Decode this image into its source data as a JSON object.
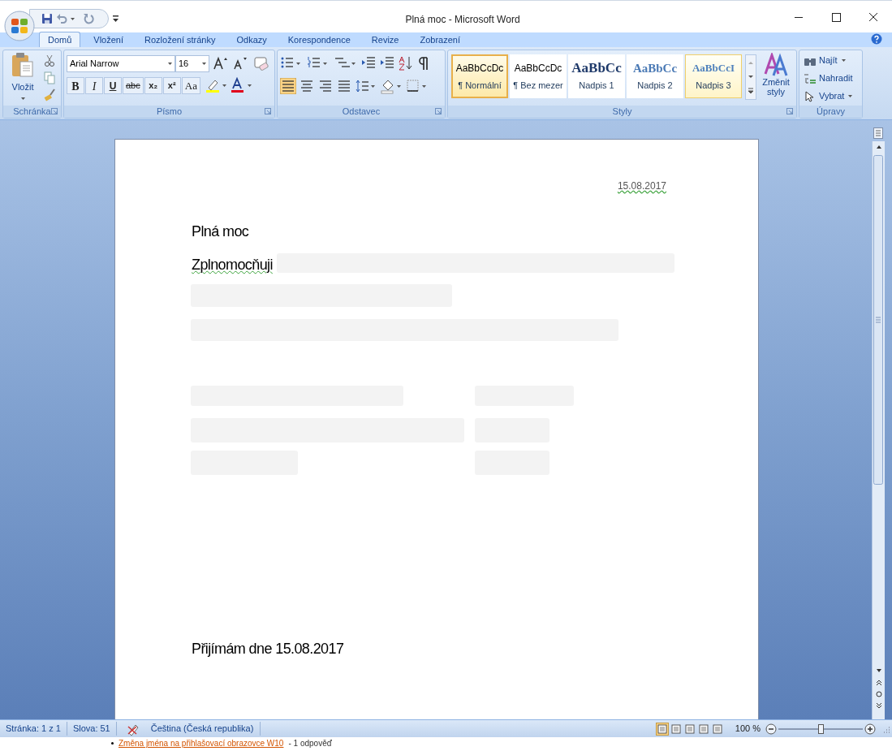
{
  "window": {
    "title": "Plná moc - Microsoft Word"
  },
  "tabs": [
    {
      "label": "Domů",
      "selected": true
    },
    {
      "label": "Vložení",
      "selected": false
    },
    {
      "label": "Rozložení stránky",
      "selected": false
    },
    {
      "label": "Odkazy",
      "selected": false
    },
    {
      "label": "Korespondence",
      "selected": false
    },
    {
      "label": "Revize",
      "selected": false
    },
    {
      "label": "Zobrazení",
      "selected": false
    }
  ],
  "ribbon": {
    "clipboard": {
      "label": "Schránka",
      "paste": "Vložit"
    },
    "font": {
      "label": "Písmo",
      "font_name": "Arial Narrow",
      "font_size": "16",
      "format_buttons": [
        {
          "kind": "bold",
          "text": "B"
        },
        {
          "kind": "italic",
          "text": "I"
        },
        {
          "kind": "underline",
          "text": "U"
        },
        {
          "kind": "strike",
          "text": "abc"
        },
        {
          "kind": "sub",
          "text": "x₂"
        },
        {
          "kind": "sup",
          "text": "x²"
        },
        {
          "kind": "case",
          "text": "Aa"
        }
      ]
    },
    "paragraph": {
      "label": "Odstavec"
    },
    "styles": {
      "label": "Styly",
      "items": [
        {
          "kind": "normal",
          "sample": "AaBbCcDc",
          "name": "¶ Normální",
          "selected": true,
          "hovered": false
        },
        {
          "kind": "normal",
          "sample": "AaBbCcDc",
          "name": "¶ Bez mezer",
          "selected": false,
          "hovered": false
        },
        {
          "kind": "heading1",
          "sample": "AaBbCc",
          "name": "Nadpis 1",
          "selected": false,
          "hovered": false
        },
        {
          "kind": "heading2",
          "sample": "AaBbCc",
          "name": "Nadpis 2",
          "selected": false,
          "hovered": false
        },
        {
          "kind": "heading3",
          "sample": "AaBbCcI",
          "name": "Nadpis 3",
          "selected": false,
          "hovered": true
        }
      ],
      "change_styles": "Změnit styly"
    },
    "editing": {
      "label": "Úpravy",
      "find": "Najít",
      "replace": "Nahradit",
      "select": "Vybrat"
    }
  },
  "document": {
    "date": "15.08.2017",
    "title": "Plná moc",
    "first_word": "Zplnomocňuji",
    "acceptance": "Přijímám dne 15.08.2017"
  },
  "status_bar": {
    "page": "Stránka: 1 z 1",
    "words": "Slova: 51",
    "language": "Čeština (Česká republika)",
    "views": [
      {
        "selected": true
      },
      {
        "selected": false
      },
      {
        "selected": false
      },
      {
        "selected": false
      },
      {
        "selected": false
      }
    ],
    "zoom": "100 %",
    "zoom_slider": {
      "level": 0.5
    }
  },
  "background_page": {
    "link": "Změna jména na přihlašovací obrazovce W10",
    "replies": "- 1 odpověď"
  }
}
